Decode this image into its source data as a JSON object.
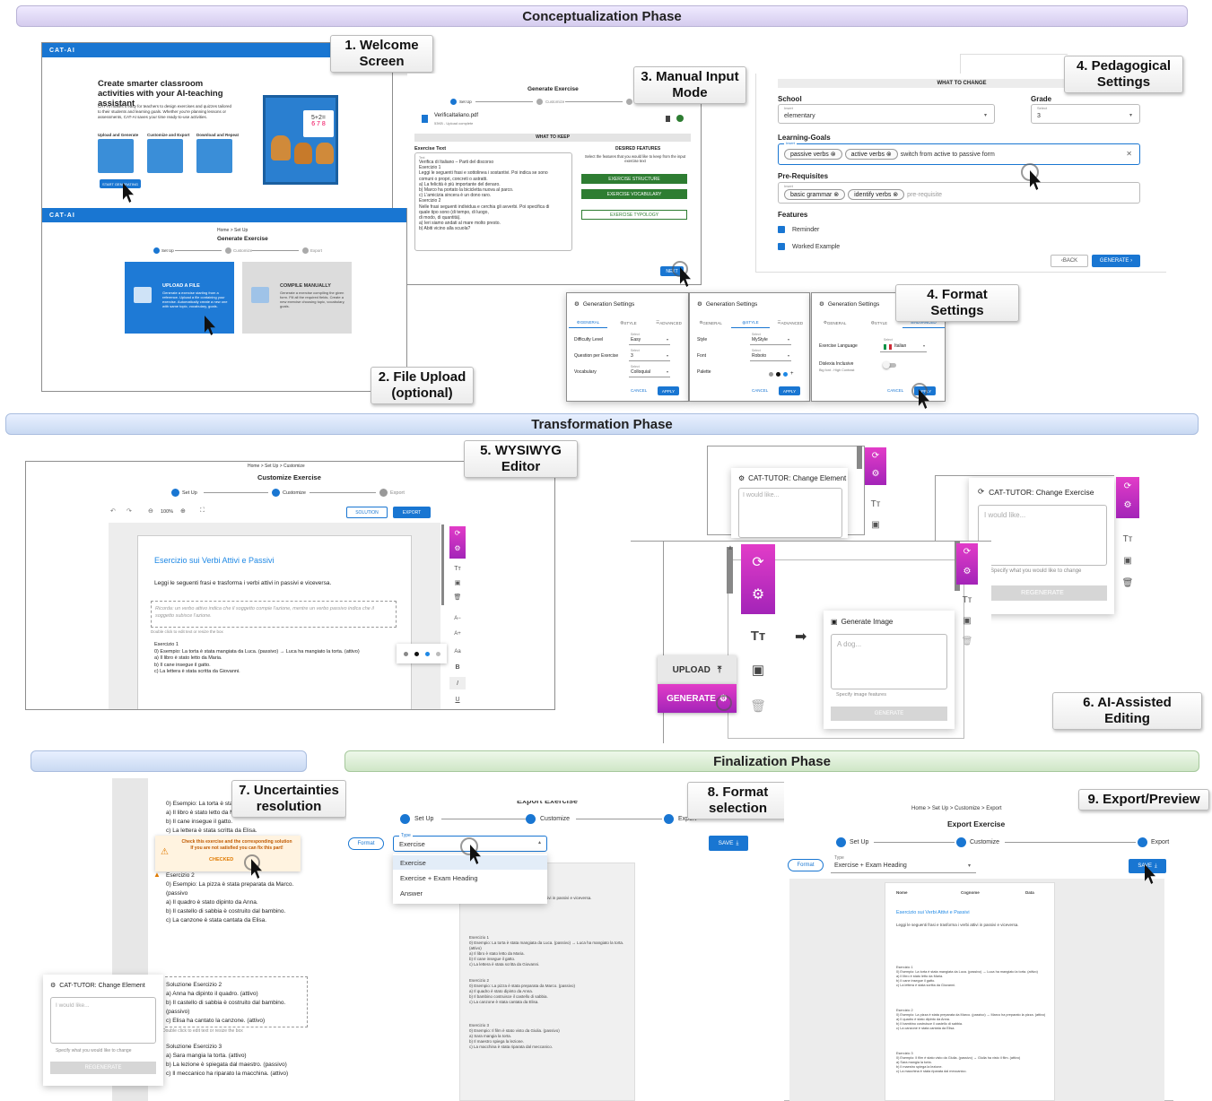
{
  "phases": {
    "conceptualization": "Conceptualization Phase",
    "transformation": "Transformation Phase",
    "finalization": "Finalization Phase"
  },
  "callouts": {
    "c1": "1. Welcome Screen",
    "c2": "2. File Upload (optional)",
    "c3": "3. Manual Input Mode",
    "c4a": "4. Pedagogical Settings",
    "c4b": "4. Format Settings",
    "c5": "5. WYSIWYG Editor",
    "c6": "6. AI-Assisted Editing",
    "c7": "7. Uncertainties resolution",
    "c8": "8. Format selection",
    "c9": "9.  Export/Preview"
  },
  "welcome": {
    "brand": "CAT-AI",
    "headline": "Create smarter classroom activities with your AI-teaching assistant",
    "desc": "CAT-AI makes it easy for teachers to design exercises and quizzes tailored to their students and learning goals. Whether you're planning lessons or assessments, CAT-AI saves your time ready-to-use activities.",
    "steps": [
      "Upload and Generate",
      "Customize and Export",
      "Download and Repeat"
    ],
    "cta": "START GENERATING"
  },
  "upload": {
    "brand": "CAT-AI",
    "breadcrumb": "Home  >  Set Up",
    "title": "Generate Exercise",
    "steps": [
      "Set Up",
      "Customize",
      "Export"
    ],
    "card1_title": "UPLOAD A FILE",
    "card1_desc": "Generate a exercise starting from a reference. Upload a file containing your exercise. Automatically create a new one with same topic, vocabulary, goals.",
    "card2_title": "COMPILE MANUALLY",
    "card2_desc": "Generate a exercise compiling the given form. Fill all the required fields. Create a new exercise choosing topic, vocabulary, goals."
  },
  "manual": {
    "title": "Generate Exercise",
    "steps": [
      "Set Up",
      "Customize",
      "Export"
    ],
    "file_name": "VerificaItaliano.pdf",
    "file_status": "53KB - Upload complete",
    "what_to_keep": "WHAT TO KEEP",
    "exercise_text_label": "Exercise Text",
    "text_hint": "Text",
    "exercise_text": [
      "Verifica di Italiano – Parti del discorso",
      "Esercizio 1",
      "Leggi le seguenti frasi e sottolinea i sostantivi. Poi indica se sono",
      "comuni o propri, concreti o astratti.",
      "a) La felicità è più importante del denaro.",
      "b) Marco ha portato la bicicletta nuova al parco.",
      "c) L'amicizia sincera è un dono raro.",
      "Esercizio 2",
      "Nelle frasi seguenti individua e cerchia gli avverbi. Poi specifica di",
      "quale tipo sono (di tempo, di luogo,",
      "di modo, di quantità).",
      "a) Ieri siamo andati al mare molto presto.",
      "b) Abiti vicino alla scuola?"
    ],
    "desired_features": "DESIRED FEATURES",
    "desired_desc": "Select the features that you would like to keep from the input exercise text",
    "features": [
      "EXERCISE STRUCTURE",
      "EXERCISE VOCABULARY",
      "EXERCISE TYPOLOGY"
    ],
    "next": "NEXT"
  },
  "pedagogical": {
    "what_to_change": "WHAT TO CHANGE",
    "school_label": "School",
    "insert": "Insert",
    "school_value": "elementary",
    "grade_label": "Grade",
    "select": "Select",
    "grade_value": "3",
    "goals_label": "Learning-Goals",
    "goals_chips": [
      "passive verbs",
      "active verbs"
    ],
    "goals_typing": "switch from active to passive form",
    "prereq_label": "Pre-Requisites",
    "prereq_chips": [
      "basic grammar",
      "identify verbs"
    ],
    "prereq_placeholder": "pre-requisite",
    "features_label": "Features",
    "feature_items": [
      "Reminder",
      "Worked Example"
    ],
    "back": "BACK",
    "generate": "GENERATE"
  },
  "format_settings": {
    "title": "Generation Settings",
    "tabs": [
      "GENERAL",
      "STYLE",
      "ADVANCED"
    ],
    "general_rows": [
      {
        "label": "Difficulty Level",
        "value": "Easy"
      },
      {
        "label": "Question per Exercise",
        "value": "3"
      },
      {
        "label": "Vocabulary",
        "value": "Colloquial"
      }
    ],
    "style_rows": [
      {
        "label": "Style",
        "value": "MyStyle"
      },
      {
        "label": "Font",
        "value": "Roboto"
      },
      {
        "label": "Palette",
        "value": ""
      }
    ],
    "advanced_language_label": "Exercise Language",
    "advanced_language": "Italian",
    "dyslexia_label": "Dislexia Inclusive",
    "dyslexia_sub": "Big font - High Contrast",
    "select_hint": "Select",
    "cancel": "CANCEL",
    "apply": "APPLY"
  },
  "wysiwyg": {
    "breadcrumb": "Home  >  Set Up  >  Customize",
    "title": "Customize Exercise",
    "steps": [
      "Set Up",
      "Customize",
      "Export"
    ],
    "zoom": "100%",
    "solution": "SOLUTION",
    "export": "EXPORT",
    "doc_title": "Esercizio sui Verbi Attivi e Passivi",
    "doc_instr": "Leggi le seguenti frasi e trasforma i verbi attivi in passivi e viceversa.",
    "doc_reminder": "Ricorda: un verbo attivo indica che il soggetto compie l'azione, mentre un verbo passivo indica che il soggetto subisce l'azione.",
    "doc_hint": "Double click to edit text or resize the box",
    "doc_lines": [
      "Esercizio 1",
      "0) Esempio: La torta è stata mangiata da Luca. (passivo) → Luca ha mangiato la torta. (attivo)",
      "a) Il libro è stato letto da Maria.",
      "b) Il cane insegue il gatto.",
      "c) La lettera è stata scritta da Giovanni."
    ],
    "toolbar": [
      "A−",
      "A+",
      "Aa",
      "B",
      "I",
      "U"
    ]
  },
  "ai_editing": {
    "change_element": "CAT-TUTOR: Change Element",
    "change_exercise": "CAT-TUTOR: Change Exercise",
    "would_like": "I would like...",
    "specify": "Specify what you would like to change",
    "regenerate": "REGENERATE",
    "generate_image": "Generate Image",
    "dog": "A dog...",
    "specify_image": "Specify image features",
    "generate_btn": "GENERATE",
    "upload": "UPLOAD",
    "generate": "GENERATE"
  },
  "uncert": {
    "lines_top": [
      "0) Esempio: La torta è stat",
      "a) Il libro è stato letto da M",
      "b) Il cane insegue il gatto.",
      "c) La lettera è stata scritta da Elisa."
    ],
    "warn1": "Check this exercise and the corresponding solution",
    "warn2": "If you are not satisfied you can fix this part!",
    "checked": "CHECKED",
    "ex2_title": "Esercizio 2",
    "ex2_lines": [
      "0) Esempio: La pizza è stata preparata da Marco. (passivo",
      "a) Il quadro è stato dipinto da Anna.",
      "b) Il castello di sabbia è costruito dal bambino.",
      "c) La canzone è stata cantata da Elisa."
    ],
    "sol2_title": "Soluzione Esercizio 2",
    "sol2_lines": [
      "a) Anna ha dipinto il quadro. (attivo)",
      "b) Il castello di sabbia è costruito dal bambino. (passivo)",
      "c) Elisa ha cantato la canzone. (attivo)"
    ],
    "hint": "Double click to edit text or resize the box",
    "sol3_title": "Soluzione Esercizio 3",
    "sol3_lines": [
      "a) Sara mangia la torta. (attivo)",
      "b) La lezione è spiegata dal maestro. (passivo)",
      "c) Il meccanico ha riparato la macchina. (attivo)"
    ],
    "change_element": "CAT-TUTOR: Change Element",
    "would_like": "I would like...",
    "specify": "Specify what you would like to change",
    "regenerate": "REGENERATE"
  },
  "format_sel": {
    "title": "Export Exercise",
    "steps": [
      "Set Up",
      "Customize",
      "Export"
    ],
    "format": "Format",
    "type_label": "Type",
    "type_value": "Exercise",
    "save": "SAVE",
    "options": [
      "Exercise",
      "Exercise + Exam Heading",
      "Answer"
    ]
  },
  "export_prev": {
    "breadcrumb": "Home  >  Set Up  >  Customize  >  Export",
    "title": "Export Exercise",
    "steps": [
      "Set Up",
      "Customize",
      "Export"
    ],
    "format": "Format",
    "type_label": "Type",
    "type_value": "Exercise + Exam Heading",
    "save": "SAVE",
    "heading": [
      "Nome",
      "Cognome",
      "Data"
    ],
    "doc_title": "Esercizio sui Verbi Attivi e Passivi",
    "doc_instr": "Leggi le seguenti frasi e trasforma i verbi attivi in passivi e viceversa."
  },
  "colors": {
    "blue": "#1976d2",
    "green": "#2e7d32",
    "magenta": "#c030c0"
  }
}
